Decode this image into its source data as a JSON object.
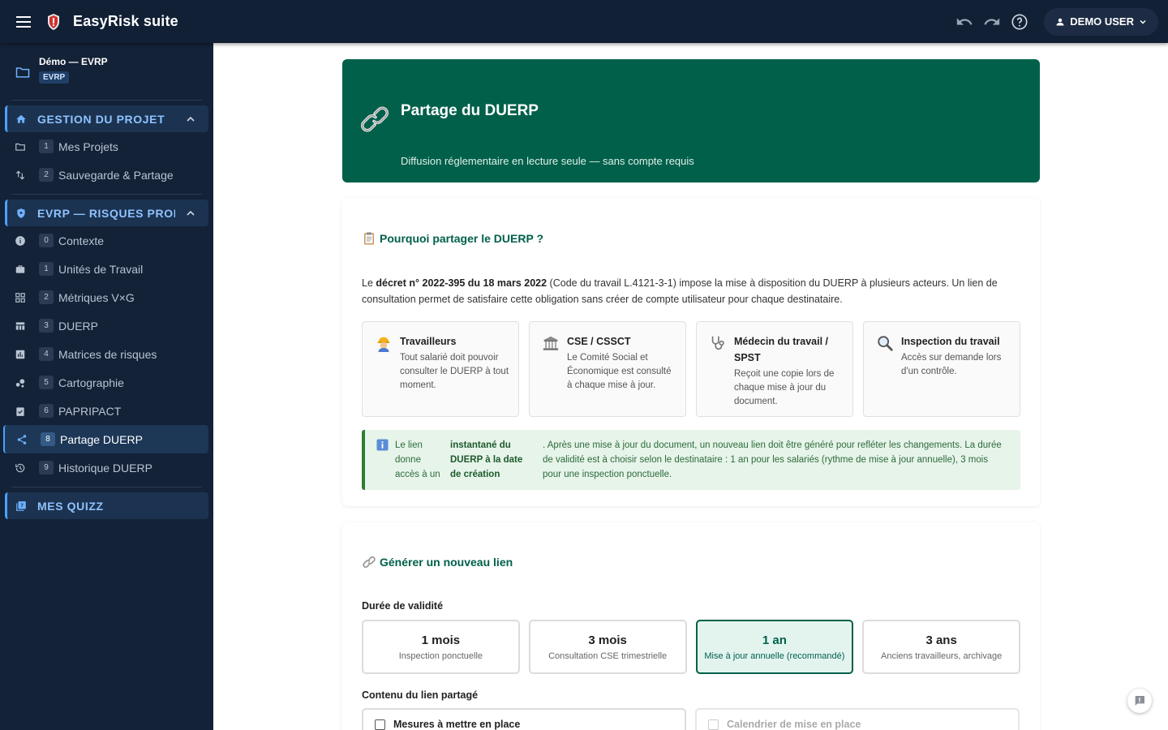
{
  "app": {
    "title": "EasyRisk suite",
    "user_label": "DEMO USER"
  },
  "project": {
    "name": "Démo — EVRP",
    "badge": "EVRP"
  },
  "sidebar": {
    "sections": [
      {
        "label": "GESTION DU PROJET",
        "items": [
          {
            "num": "1",
            "label": "Mes Projets",
            "icon": "folder-icon"
          },
          {
            "num": "2",
            "label": "Sauvegarde & Partage",
            "icon": "sync-icon"
          }
        ]
      },
      {
        "label": "EVRP — RISQUES PROFE",
        "items": [
          {
            "num": "0",
            "label": "Contexte",
            "icon": "info-icon"
          },
          {
            "num": "1",
            "label": "Unités de Travail",
            "icon": "briefcase-icon"
          },
          {
            "num": "2",
            "label": "Métriques V×G",
            "icon": "grid-icon"
          },
          {
            "num": "3",
            "label": "DUERP",
            "icon": "table-icon"
          },
          {
            "num": "4",
            "label": "Matrices de risques",
            "icon": "chart-icon"
          },
          {
            "num": "5",
            "label": "Cartographie",
            "icon": "bubble-icon"
          },
          {
            "num": "6",
            "label": "PAPRIPACT",
            "icon": "clipboard-check-icon"
          },
          {
            "num": "8",
            "label": "Partage DUERP",
            "icon": "share-icon",
            "active": true
          },
          {
            "num": "9",
            "label": "Historique DUERP",
            "icon": "history-icon"
          }
        ]
      },
      {
        "label": "MES QUIZZ",
        "items": []
      }
    ]
  },
  "hero": {
    "title": "Partage du DUERP",
    "subtitle": "Diffusion réglementaire en lecture seule — sans compte requis"
  },
  "why": {
    "title": "Pourquoi partager le DUERP ?",
    "intro_prefix": "Le ",
    "intro_bold": "décret n° 2022-395 du 18 mars 2022",
    "intro_rest": " (Code du travail L.4121-3-1) impose la mise à disposition du DUERP à plusieurs acteurs. Un lien de consultation permet de satisfaire cette obligation sans créer de compte utilisateur pour chaque destinataire.",
    "actors": [
      {
        "icon": "worker-icon",
        "title": "Travailleurs",
        "desc": "Tout salarié doit pouvoir consulter le DUERP à tout moment."
      },
      {
        "icon": "building-icon",
        "title": "CSE / CSSCT",
        "desc": "Le Comité Social et Économique est consulté à chaque mise à jour."
      },
      {
        "icon": "stethoscope-icon",
        "title": "Médecin du travail / SPST",
        "desc": "Reçoit une copie lors de chaque mise à jour du document."
      },
      {
        "icon": "magnifier-icon",
        "title": "Inspection du travail",
        "desc": "Accès sur demande lors d'un contrôle."
      }
    ],
    "info_part1": "Le lien donne accès à un",
    "info_bold": "instantané du DUERP à la date de création",
    "info_part2": ". Après une mise à jour du document, un nouveau lien doit être généré pour refléter les changements. La durée de validité est à choisir selon le destinataire : 1 an pour les salariés (rythme de mise à jour annuelle), 3 mois pour une inspection ponctuelle."
  },
  "generate": {
    "title": "Générer un nouveau lien",
    "duration_label": "Durée de validité",
    "durations": [
      {
        "value": "1 mois",
        "sub": "Inspection ponctuelle",
        "selected": false
      },
      {
        "value": "3 mois",
        "sub": "Consultation CSE trimestrielle",
        "selected": false
      },
      {
        "value": "1 an",
        "sub": "Mise à jour annuelle (recommandé)",
        "selected": true
      },
      {
        "value": "3 ans",
        "sub": "Anciens travailleurs, archivage",
        "selected": false
      }
    ],
    "content_label": "Contenu du lien partagé",
    "contents": [
      {
        "label": "Mesures à mettre en place",
        "disabled": false
      },
      {
        "label": "Calendrier de mise en place",
        "disabled": true
      }
    ]
  },
  "colors": {
    "topbar": "#122035",
    "sidebar": "#132237",
    "accent": "#00604a",
    "sidebar_accent": "#4aa3ff"
  }
}
